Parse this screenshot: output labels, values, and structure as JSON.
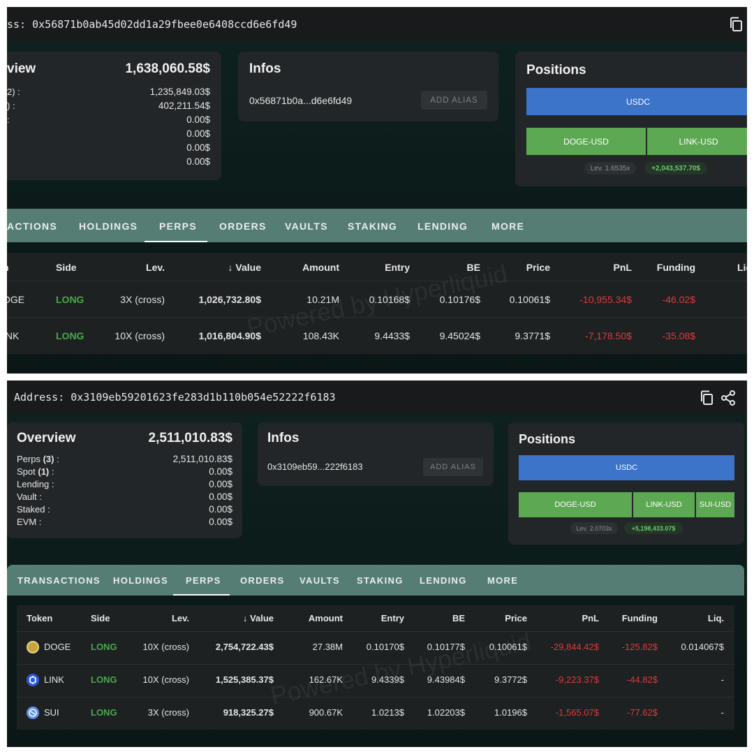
{
  "top": {
    "address_bar": {
      "text": "ss: 0x56871b0ab45d02dd1a29fbee0e6408ccd6e6fd49"
    },
    "overview": {
      "title": "view",
      "total": "1,638,060.58$",
      "rows": [
        {
          "label": "2) :",
          "value": "1,235,849.03$"
        },
        {
          "label": ") :",
          "value": "402,211.54$"
        },
        {
          "label": ":",
          "value": "0.00$"
        },
        {
          "label": "",
          "value": "0.00$"
        },
        {
          "label": "",
          "value": "0.00$"
        },
        {
          "label": "",
          "value": "0.00$"
        }
      ]
    },
    "infos": {
      "title": "Infos",
      "address": "0x56871b0a...d6e6fd49",
      "alias_button": "ADD ALIAS"
    },
    "positions": {
      "title": "Positions",
      "bars": [
        "USDC",
        "DOGE-USD",
        "LINK-USD"
      ],
      "lev_label": "Lev.",
      "lev_value": "1.6535x",
      "pnl": "+2,043,537.70$"
    },
    "tabs": [
      "ACTIONS",
      "HOLDINGS",
      "PERPS",
      "ORDERS",
      "VAULTS",
      "STAKING",
      "LENDING",
      "MORE"
    ],
    "table": {
      "headers": [
        "n",
        "Side",
        "Lev.",
        "↓ Value",
        "Amount",
        "Entry",
        "BE",
        "Price",
        "PnL",
        "Funding",
        "Lic"
      ],
      "rows": [
        [
          "OGE",
          "LONG",
          "3X (cross)",
          "1,026,732.80$",
          "10.21M",
          "0.10168$",
          "0.10176$",
          "0.10061$",
          "-10,955.34$",
          "-46.02$"
        ],
        [
          "INK",
          "LONG",
          "10X (cross)",
          "1,016,804.90$",
          "108.43K",
          "9.4433$",
          "9.45024$",
          "9.3771$",
          "-7,178.50$",
          "-35.08$"
        ]
      ]
    },
    "watermark": "Powered by Hyperliquid"
  },
  "bottom": {
    "address_bar": {
      "label": "Address:",
      "text": "0x3109eb59201623fe283d1b110b054e52222f6183"
    },
    "overview": {
      "title": "Overview",
      "total": "2,511,010.83$",
      "rows": [
        {
          "label": "Perps",
          "count": "(3)",
          "suffix": " :",
          "value": "2,511,010.83$"
        },
        {
          "label": "Spot",
          "count": "(1)",
          "suffix": " :",
          "value": "0.00$"
        },
        {
          "label": "Lending :",
          "count": "",
          "suffix": "",
          "value": "0.00$"
        },
        {
          "label": "Vault :",
          "count": "",
          "suffix": "",
          "value": "0.00$"
        },
        {
          "label": "Staked :",
          "count": "",
          "suffix": "",
          "value": "0.00$"
        },
        {
          "label": "EVM :",
          "count": "",
          "suffix": "",
          "value": "0.00$"
        }
      ]
    },
    "infos": {
      "title": "Infos",
      "address": "0x3109eb59...222f6183",
      "alias_button": "ADD ALIAS"
    },
    "positions": {
      "title": "Positions",
      "bars": [
        "USDC",
        "DOGE-USD",
        "LINK-USD",
        "SUI-USD"
      ],
      "lev_label": "Lev.",
      "lev_value": "2.0703x",
      "pnl": "+5,198,433.07$"
    },
    "tabs": [
      "TRANSACTIONS",
      "HOLDINGS",
      "PERPS",
      "ORDERS",
      "VAULTS",
      "STAKING",
      "LENDING",
      "MORE"
    ],
    "table": {
      "headers": [
        "Token",
        "Side",
        "Lev.",
        "↓ Value",
        "Amount",
        "Entry",
        "BE",
        "Price",
        "PnL",
        "Funding",
        "Liq."
      ],
      "rows": [
        [
          "DOGE",
          "LONG",
          "10X (cross)",
          "2,754,722.43$",
          "27.38M",
          "0.10170$",
          "0.10177$",
          "0.10061$",
          "-29,844.42$",
          "-125.82$",
          "0.014067$"
        ],
        [
          "LINK",
          "LONG",
          "10X (cross)",
          "1,525,385.37$",
          "162.67K",
          "9.4339$",
          "9.43984$",
          "9.3772$",
          "-9,223.37$",
          "-44.82$",
          "-"
        ],
        [
          "SUI",
          "LONG",
          "3X (cross)",
          "918,325.27$",
          "900.67K",
          "1.0213$",
          "1.02203$",
          "1.0196$",
          "-1,565.07$",
          "-77.62$",
          "-"
        ]
      ]
    },
    "watermark": "Powered by Hyperliquid"
  },
  "colors": {
    "usdc_bar": "#3b74c9",
    "token_bar": "#5da953",
    "long": "#4aa84c",
    "negative": "#e0393c",
    "tabbar": "#567d74"
  },
  "icons": [
    "copy-icon",
    "share-icon",
    "doge-icon",
    "link-token-icon",
    "sui-icon"
  ]
}
